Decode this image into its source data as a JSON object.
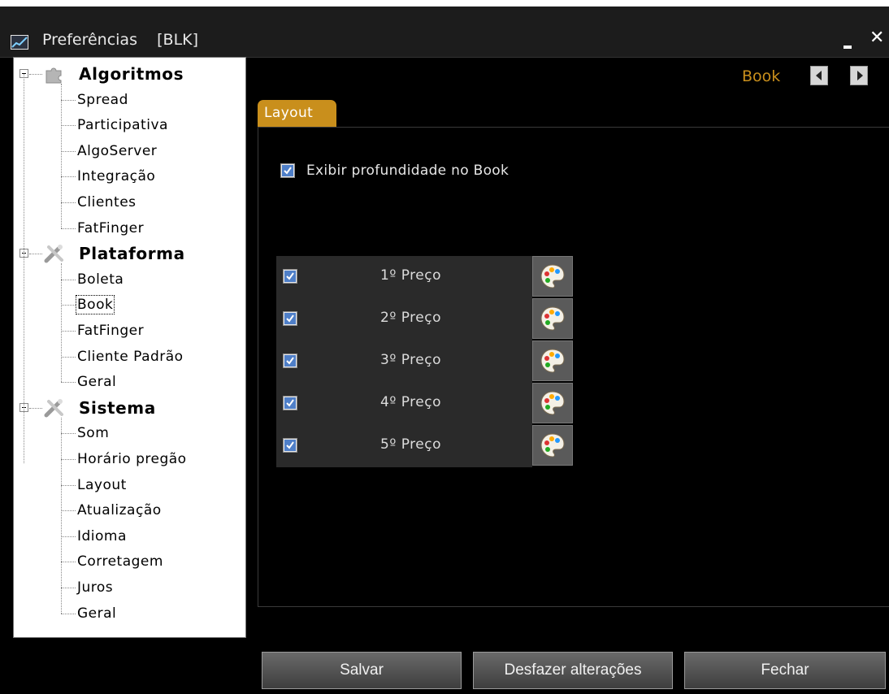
{
  "window": {
    "title": "Preferências    [BLK]",
    "minimize_glyph": "-",
    "close_glyph": "✕"
  },
  "tree": {
    "groups": [
      {
        "label": "Algoritmos",
        "icon": "puzzle-icon",
        "items": [
          "Spread",
          "Participativa",
          "AlgoServer",
          "Integração",
          "Clientes",
          "FatFinger"
        ]
      },
      {
        "label": "Plataforma",
        "icon": "tools-icon",
        "items": [
          "Boleta",
          "Book",
          "FatFinger",
          "Cliente Padrão",
          "Geral"
        ]
      },
      {
        "label": "Sistema",
        "icon": "tools-icon",
        "items": [
          "Som",
          "Horário pregão",
          "Layout",
          "Atualização",
          "Idioma",
          "Corretagem",
          "Juros",
          "Geral"
        ]
      }
    ],
    "selected": "Book"
  },
  "header": {
    "section_title": "Book"
  },
  "tabs": [
    {
      "label": "Layout",
      "active": true
    }
  ],
  "layout": {
    "depth_checkbox": {
      "label": "Exibir profundidade no Book",
      "checked": true
    },
    "price_rows": [
      {
        "label": "1º Preço",
        "checked": true
      },
      {
        "label": "2º Preço",
        "checked": true
      },
      {
        "label": "3º Preço",
        "checked": true
      },
      {
        "label": "4º Preço",
        "checked": true
      },
      {
        "label": "5º Preço",
        "checked": true
      }
    ]
  },
  "footer": {
    "save": "Salvar",
    "undo": "Desfazer alterações",
    "close": "Fechar"
  },
  "colors": {
    "accent": "#c98f1c",
    "background": "#000000",
    "row_bg": "#2a2a2a"
  }
}
